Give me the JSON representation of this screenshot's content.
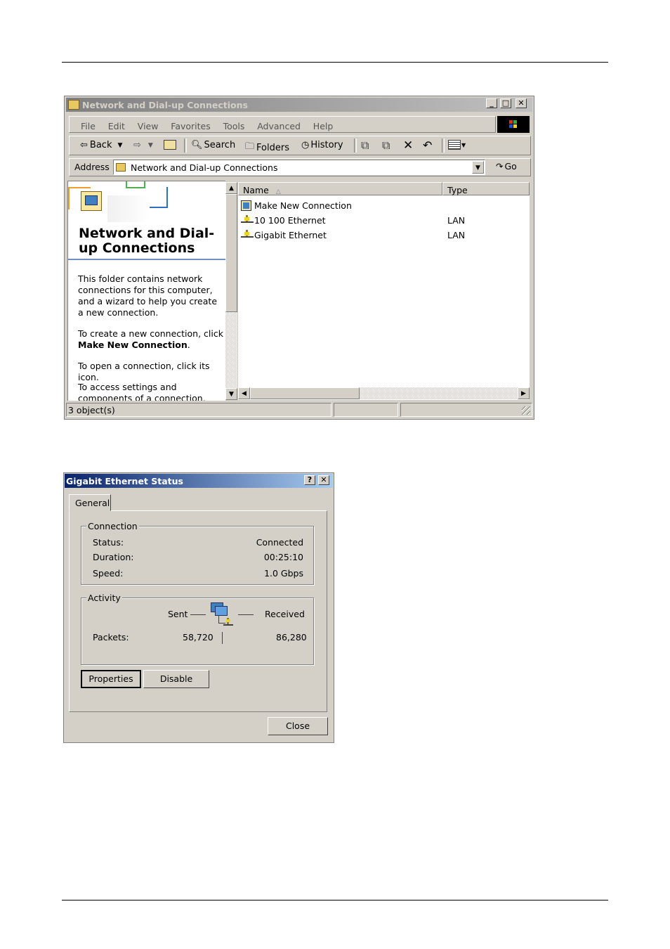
{
  "explorer": {
    "title": "Network and Dial-up Connections",
    "menu": [
      "File",
      "Edit",
      "View",
      "Favorites",
      "Tools",
      "Advanced",
      "Help"
    ],
    "toolbar": {
      "back": "Back",
      "search": "Search",
      "folders": "Folders",
      "history": "History"
    },
    "address": {
      "label": "Address",
      "value": "Network and Dial-up Connections",
      "go": "Go"
    },
    "left_pane": {
      "heading": "Network and Dial-up Connections",
      "p1": "This folder contains network connections for this computer, and a wizard to help you create a new connection.",
      "p2_prefix": "To create a new connection, click",
      "p2_bold": "Make New Connection",
      "p2_suffix": ".",
      "p3": "To open a connection, click its icon.",
      "p4": "To access settings and components of a connection, right-click its icon"
    },
    "columns": {
      "name": "Name",
      "type": "Type"
    },
    "items": [
      {
        "name": "Make New Connection",
        "type": "",
        "icon": "new-connection-icon"
      },
      {
        "name": "10 100 Ethernet",
        "type": "LAN",
        "icon": "lan-connection-icon"
      },
      {
        "name": "Gigabit Ethernet",
        "type": "LAN",
        "icon": "lan-connection-icon"
      }
    ],
    "status": "3 object(s)"
  },
  "dialog": {
    "title": "Gigabit Ethernet Status",
    "tab": "General",
    "connection": {
      "label": "Connection",
      "status_label": "Status:",
      "status_value": "Connected",
      "duration_label": "Duration:",
      "duration_value": "00:25:10",
      "speed_label": "Speed:",
      "speed_value": "1.0 Gbps"
    },
    "activity": {
      "label": "Activity",
      "sent": "Sent",
      "received": "Received",
      "packets_label": "Packets:",
      "packets_sent": "58,720",
      "packets_received": "86,280"
    },
    "properties_button": "Properties",
    "disable_button": "Disable",
    "close_button": "Close"
  }
}
